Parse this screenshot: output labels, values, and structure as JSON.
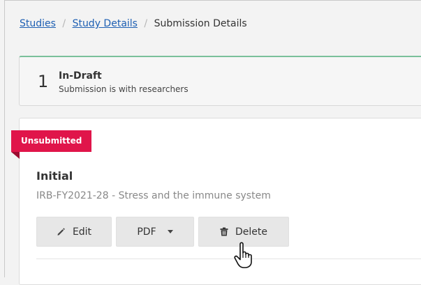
{
  "breadcrumb": {
    "items": [
      {
        "label": "Studies"
      },
      {
        "label": "Study Details"
      }
    ],
    "current": "Submission Details",
    "separator": "/"
  },
  "status": {
    "number": "1",
    "title": "In-Draft",
    "subtitle": "Submission is with researchers",
    "accent_color": "#7ac09a"
  },
  "submission": {
    "badge": "Unsubmitted",
    "badge_color": "#e0154a",
    "title": "Initial",
    "description": "IRB-FY2021-28 - Stress and the immune system"
  },
  "actions": {
    "edit_label": "Edit",
    "pdf_label": "PDF",
    "delete_label": "Delete"
  },
  "icons": {
    "edit": "pencil-icon",
    "pdf": "caret-down-icon",
    "delete": "trash-icon",
    "cursor": "hand-pointer-cursor"
  }
}
